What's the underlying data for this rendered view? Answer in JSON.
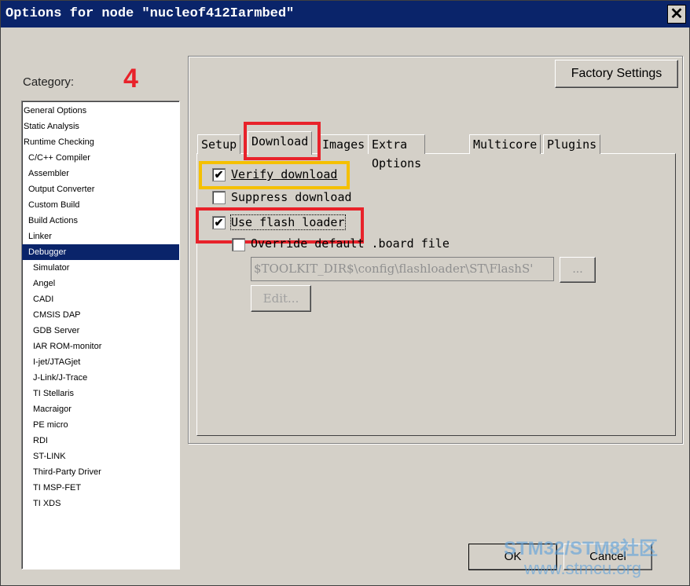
{
  "window": {
    "title": "Options for node \"nucleof412Iarmbed\"",
    "close": "✕"
  },
  "annotation_step": "4",
  "category": {
    "label": "Category:",
    "items": [
      {
        "label": "General Options",
        "indent": 0
      },
      {
        "label": "Static Analysis",
        "indent": 0
      },
      {
        "label": "Runtime Checking",
        "indent": 0
      },
      {
        "label": "C/C++ Compiler",
        "indent": 1
      },
      {
        "label": "Assembler",
        "indent": 1
      },
      {
        "label": "Output Converter",
        "indent": 1
      },
      {
        "label": "Custom Build",
        "indent": 1
      },
      {
        "label": "Build Actions",
        "indent": 1
      },
      {
        "label": "Linker",
        "indent": 1
      },
      {
        "label": "Debugger",
        "indent": 1,
        "selected": true
      },
      {
        "label": "Simulator",
        "indent": 2
      },
      {
        "label": "Angel",
        "indent": 2
      },
      {
        "label": "CADI",
        "indent": 2
      },
      {
        "label": "CMSIS DAP",
        "indent": 2
      },
      {
        "label": "GDB Server",
        "indent": 2
      },
      {
        "label": "IAR ROM-monitor",
        "indent": 2
      },
      {
        "label": "I-jet/JTAGjet",
        "indent": 2
      },
      {
        "label": "J-Link/J-Trace",
        "indent": 2
      },
      {
        "label": "TI Stellaris",
        "indent": 2
      },
      {
        "label": "Macraigor",
        "indent": 2
      },
      {
        "label": "PE micro",
        "indent": 2
      },
      {
        "label": "RDI",
        "indent": 2
      },
      {
        "label": "ST-LINK",
        "indent": 2
      },
      {
        "label": "Third-Party Driver",
        "indent": 2
      },
      {
        "label": "TI MSP-FET",
        "indent": 2
      },
      {
        "label": "TI XDS",
        "indent": 2
      }
    ]
  },
  "factory_settings": "Factory Settings",
  "tabs": [
    "Setup",
    "Download",
    "Images",
    "Extra Options",
    "Multicore",
    "Plugins"
  ],
  "active_tab": "Download",
  "options": {
    "verify_download": {
      "label": "Verify download",
      "checked": true
    },
    "suppress_download": {
      "label": "Suppress download",
      "checked": false
    },
    "use_flash_loader": {
      "label": "Use flash loader",
      "checked": true
    },
    "override_board": {
      "label": "Override default .board file",
      "checked": false
    },
    "board_path": "$TOOLKIT_DIR$\\config\\flashloader\\ST\\FlashS'",
    "browse": "...",
    "edit": "Edit..."
  },
  "ok": "OK",
  "cancel": "Cancel",
  "watermark": {
    "line1": "STM32/STM8社区",
    "line2": "www.stmcu.org"
  },
  "colors": {
    "highlight_red": "#e8222a",
    "highlight_yellow": "#f5c000",
    "selection": "#0a246a"
  }
}
